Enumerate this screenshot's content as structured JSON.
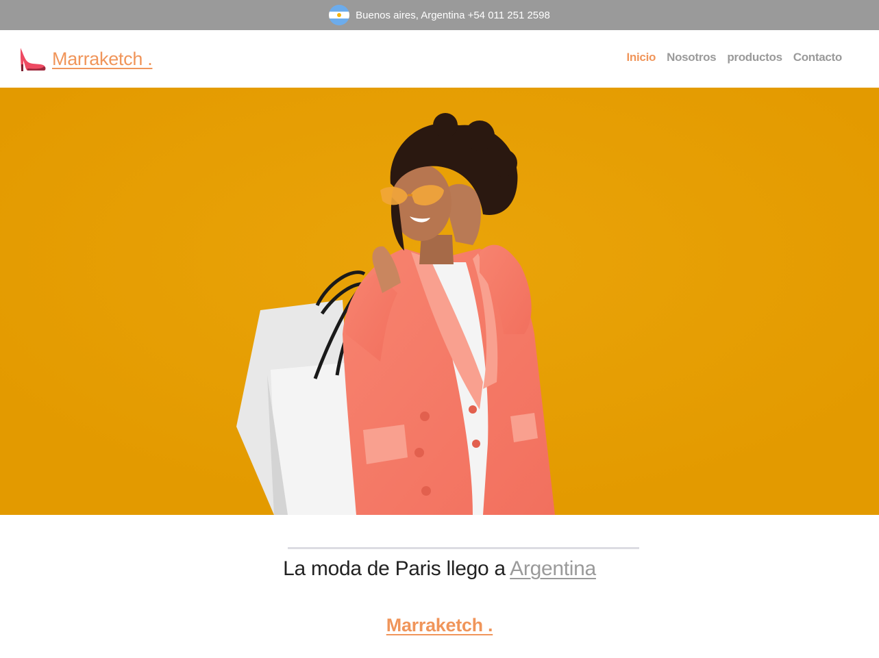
{
  "topbar": {
    "flag_icon": "argentina-flag-icon",
    "contact_text": "Buenos aires, Argentina +54 011 251 2598",
    "background": "#9a9a9a"
  },
  "header": {
    "brand_icon": "high-heel-shoe-icon",
    "brand_name": "Marraketch .",
    "nav": [
      {
        "label": "Inicio",
        "active": true
      },
      {
        "label": "Nosotros",
        "active": false
      },
      {
        "label": "productos",
        "active": false
      },
      {
        "label": "Contacto",
        "active": false
      }
    ]
  },
  "hero": {
    "image": "woman-with-shopping-bags",
    "background": "#e59c02"
  },
  "main": {
    "tagline_text": "La moda de Paris llego a",
    "tagline_link": "Argentina",
    "footer_brand": "Marraketch ."
  },
  "colors": {
    "accent": "#f0955a",
    "nav_inactive": "#9a9a9a",
    "text": "#222222"
  }
}
